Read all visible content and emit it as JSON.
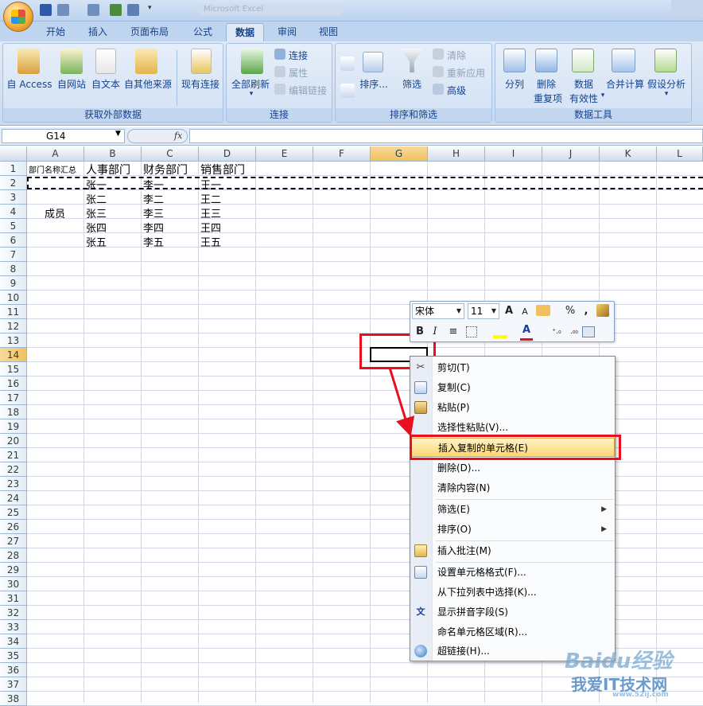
{
  "title": {
    "text": "Microsoft Excel"
  },
  "tabs": [
    "开始",
    "插入",
    "页面布局",
    "公式",
    "数据",
    "审阅",
    "视图"
  ],
  "active_tab": "数据",
  "ribbon": {
    "groups": [
      {
        "label": "获取外部数据",
        "buttons": [
          "自 Access",
          "自网站",
          "自文本",
          "自其他来源",
          "现有连接"
        ]
      },
      {
        "label": "连接",
        "buttons": [
          "全部刷新",
          "连接",
          "属性",
          "编辑链接"
        ]
      },
      {
        "label": "排序和筛选",
        "buttons": [
          "排序...",
          "筛选",
          "清除",
          "重新应用",
          "高级"
        ]
      },
      {
        "label": "数据工具",
        "buttons": [
          "分列",
          "删除",
          "重复项",
          "数据",
          "有效性",
          "合并计算",
          "假设分析"
        ]
      }
    ]
  },
  "formula_bar": {
    "name_box": "G14",
    "fx": "fx",
    "value": ""
  },
  "columns": [
    "A",
    "B",
    "C",
    "D",
    "E",
    "F",
    "G",
    "H",
    "I",
    "J",
    "K",
    "L"
  ],
  "rows": [
    "1",
    "2",
    "3",
    "4",
    "5",
    "6",
    "7",
    "8",
    "9",
    "10",
    "11",
    "12",
    "13",
    "14",
    "15",
    "16",
    "17",
    "18",
    "19",
    "20",
    "21",
    "22",
    "23",
    "24",
    "25",
    "26",
    "27",
    "28",
    "29",
    "30",
    "31",
    "32",
    "33",
    "34",
    "35",
    "36",
    "37",
    "38"
  ],
  "cells": {
    "a1": "部门名称汇总",
    "b1": "人事部门",
    "c1": "财务部门",
    "d1": "销售部门",
    "a4": "成员",
    "b2": "张一",
    "c2": "李一",
    "d2": "王一",
    "b3": "张二",
    "c3": "李二",
    "d3": "王二",
    "b4": "张三",
    "c4": "李三",
    "d4": "王三",
    "b5": "张四",
    "c5": "李四",
    "d5": "王四",
    "b6": "张五",
    "c6": "李五",
    "d6": "王五"
  },
  "mini_toolbar": {
    "font": "宋体",
    "size": "11",
    "bold": "B",
    "italic": "I",
    "percent": "%",
    "comma": ","
  },
  "context_menu": {
    "items": [
      {
        "label": "剪切(T)",
        "icon": "scissors-icon"
      },
      {
        "label": "复制(C)",
        "icon": "copy-icon"
      },
      {
        "label": "粘贴(P)",
        "icon": "paste-icon"
      },
      {
        "label": "选择性粘贴(V)...",
        "icon": ""
      },
      {
        "label": "插入复制的单元格(E)",
        "icon": ""
      },
      {
        "label": "删除(D)...",
        "icon": ""
      },
      {
        "label": "清除内容(N)",
        "icon": ""
      },
      {
        "label": "筛选(E)",
        "icon": "",
        "submenu": true
      },
      {
        "label": "排序(O)",
        "icon": "",
        "submenu": true
      },
      {
        "label": "插入批注(M)",
        "icon": "comment-icon"
      },
      {
        "label": "设置单元格格式(F)...",
        "icon": "format-icon"
      },
      {
        "label": "从下拉列表中选择(K)...",
        "icon": ""
      },
      {
        "label": "显示拼音字段(S)",
        "icon": "phonetic-icon"
      },
      {
        "label": "命名单元格区域(R)...",
        "icon": ""
      },
      {
        "label": "超链接(H)...",
        "icon": "hyperlink-icon"
      }
    ],
    "highlighted_index": 4
  },
  "watermark": {
    "line1": "Baidu经验",
    "line2": "我爱IT技术网",
    "line3": "www.52ij.com"
  },
  "colors": {
    "highlight_red": "#e8101d",
    "selected_header": "#f1c15f"
  }
}
